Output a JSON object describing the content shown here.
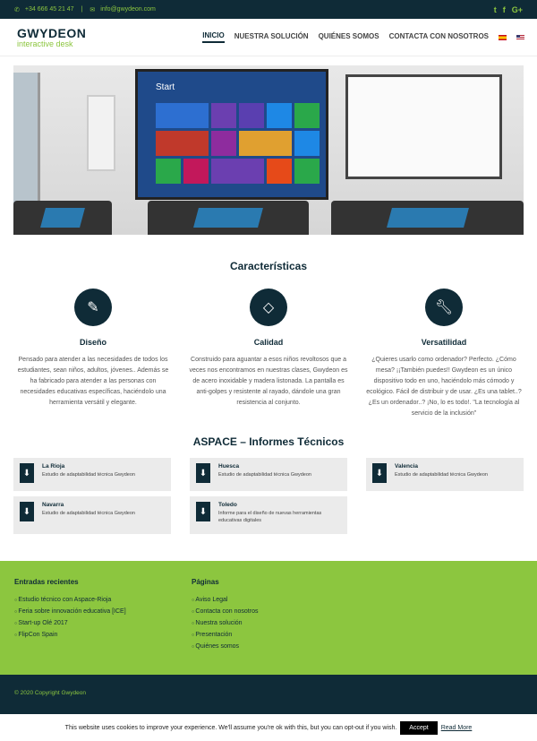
{
  "topbar": {
    "phone": "+34 666 45 21 47",
    "email": "info@gwydeon.com",
    "social": [
      "twitter-icon",
      "facebook-icon",
      "google-plus-icon"
    ]
  },
  "logo": {
    "name": "GWYDEON",
    "tagline": "interactive desk"
  },
  "nav": {
    "items": [
      "INICIO",
      "NUESTRA SOLUCIÓN",
      "QUIÉNES SOMOS",
      "CONTACTA CON NOSOTROS"
    ],
    "active": 0
  },
  "hero": {
    "screen_label": "Start"
  },
  "features": {
    "title": "Características",
    "items": [
      {
        "icon": "pencil-icon",
        "title": "Diseño",
        "text": "Pensado para atender a las necesidades de todos los estudiantes, sean niños, adultos, jóvenes.. Además se ha fabricado para atender a las personas con necesidades educativas específicas, haciéndolo una herramienta versátil y elegante."
      },
      {
        "icon": "diamond-icon",
        "title": "Calidad",
        "text": "Construido para aguantar a esos niños revoltosos que a veces nos encontramos en nuestras clases, Gwydeon es de acero inoxidable y madera listonada. La pantalla es anti-golpes y resistente al rayado, dándole una gran resistencia al conjunto."
      },
      {
        "icon": "wrench-icon",
        "title": "Versatilidad",
        "text": "¿Quieres usarlo como ordenador? Perfecto. ¿Cómo mesa? ¡¡También puedes!! Gwydeon es un único dispositivo todo en uno, haciéndolo más cómodo y ecológico. Fácil de distribuir y de usar. ¿Es una tablet..? ¿Es un ordenador..? ¡No, lo es todo!. \"La tecnología al servicio de la inclusión\""
      }
    ]
  },
  "reports": {
    "title": "ASPACE – Informes Técnicos",
    "items": [
      {
        "title": "La Rioja",
        "desc": "Estudio de adaptabilidad técnica Gwydeon"
      },
      {
        "title": "Huesca",
        "desc": "Estudio de adaptabilidad técnica Gwydeon"
      },
      {
        "title": "Valencia",
        "desc": "Estudio de adaptabilidad técnica Gwydeon"
      },
      {
        "title": "Navarra",
        "desc": "Estudio de adaptabilidad técnica Gwydeon"
      },
      {
        "title": "Toledo",
        "desc": "Informe para el diseño de nuevas herramientas educativas digitales"
      }
    ]
  },
  "footer": {
    "recent_title": "Entradas recientes",
    "recent": [
      "Estudio técnico con Aspace-Rioja",
      "Feria sobre innovación educativa [ICE]",
      "Start-up Olé 2017",
      "FlipCon Spain"
    ],
    "pages_title": "Páginas",
    "pages": [
      "Aviso Legal",
      "Contacta con nosotros",
      "Nuestra solución",
      "Presentación",
      "Quiénes somos"
    ],
    "copyright": "© 2020 Copyright Gwydeon"
  },
  "cookie": {
    "text": "This website uses cookies to improve your experience. We'll assume you're ok with this, but you can opt-out if you wish.",
    "accept": "Accept",
    "more": "Read More"
  },
  "colors": {
    "dark": "#0f2b37",
    "green": "#8cc63f"
  }
}
